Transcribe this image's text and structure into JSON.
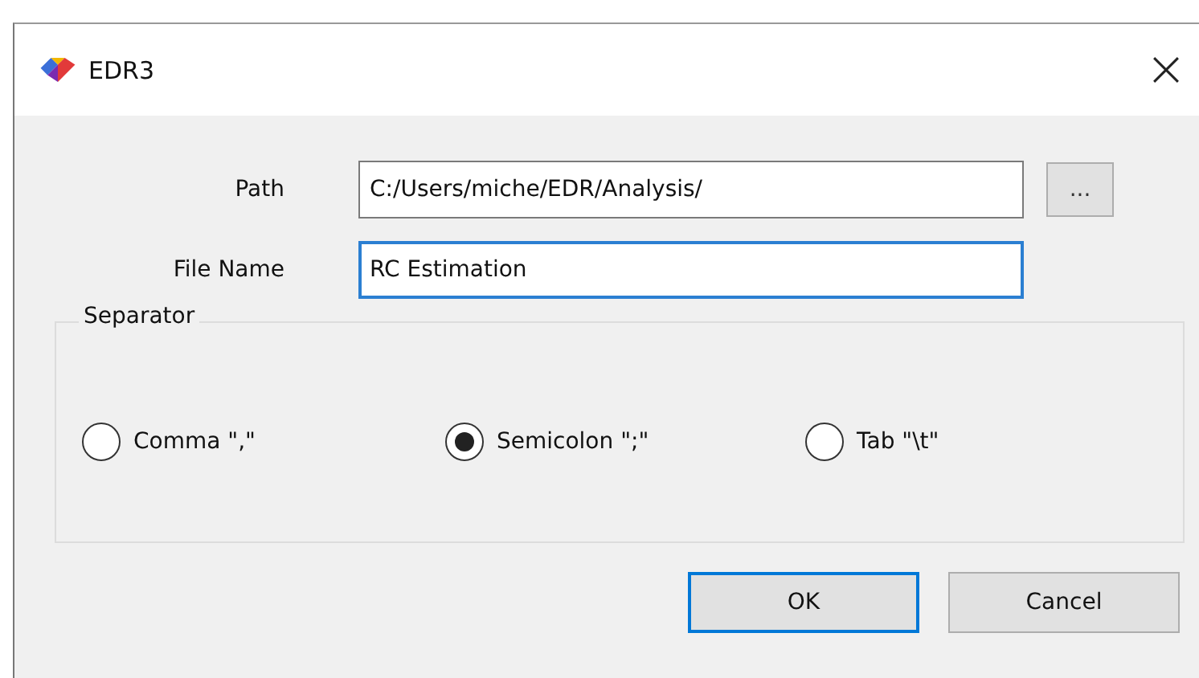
{
  "window": {
    "title": "EDR3"
  },
  "fields": [
    {
      "label": "Path",
      "value": "C:/Users/miche/EDR/Analysis/",
      "focused": false,
      "browse": "..."
    },
    {
      "label": "File Name",
      "value": "RC Estimation",
      "focused": true
    }
  ],
  "separator": {
    "title": "Separator",
    "options": [
      {
        "label": "Comma \",\"",
        "selected": false
      },
      {
        "label": "Semicolon \";\"",
        "selected": true
      },
      {
        "label": "Tab \"\\t\"",
        "selected": false
      }
    ]
  },
  "buttons": [
    {
      "label": "OK",
      "default": true
    },
    {
      "label": "Cancel",
      "default": false
    }
  ]
}
